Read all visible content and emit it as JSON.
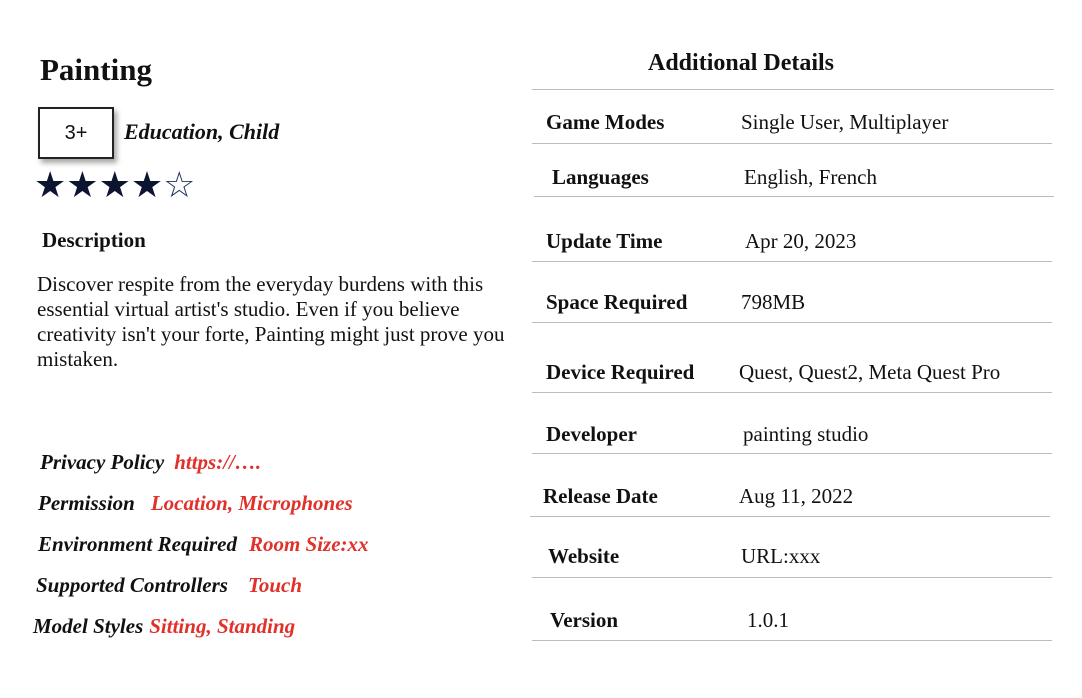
{
  "app": {
    "title": "Painting",
    "age_rating": "3+",
    "genres": "Education, Child",
    "rating_stars": 4,
    "rating_max": 5,
    "description_heading": "Description",
    "description": "Discover respite from the everyday burdens with this essential virtual artist's studio. Even if you believe creativity isn't your forte, Painting might just prove you mistaken."
  },
  "meta": [
    {
      "label": "Privacy Policy",
      "value": "https://…."
    },
    {
      "label": "Permission",
      "value": "Location, Microphones"
    },
    {
      "label": "Environment Required",
      "value": "Room Size:xx"
    },
    {
      "label": "Supported Controllers",
      "value": "Touch"
    },
    {
      "label": "Model Styles",
      "value": "Sitting, Standing"
    }
  ],
  "details": {
    "heading": "Additional Details",
    "rows": [
      {
        "label": "Game Modes",
        "value": "Single User, Multiplayer"
      },
      {
        "label": "Languages",
        "value": "English, French"
      },
      {
        "label": "Update Time",
        "value": "Apr 20, 2023"
      },
      {
        "label": "Space Required",
        "value": "798MB"
      },
      {
        "label": "Device Required",
        "value": "Quest, Quest2, Meta Quest Pro"
      },
      {
        "label": "Developer",
        "value": "painting studio"
      },
      {
        "label": "Release Date",
        "value": "Aug 11, 2022"
      },
      {
        "label": "Website",
        "value": "URL:xxx"
      },
      {
        "label": "Version",
        "value": "1.0.1"
      }
    ]
  },
  "colors": {
    "accent": "#e0312b",
    "star": "#0b1530",
    "divider": "#bcbcbc"
  },
  "icons": {
    "star_filled": "star-filled-icon",
    "star_empty": "star-outline-icon"
  }
}
